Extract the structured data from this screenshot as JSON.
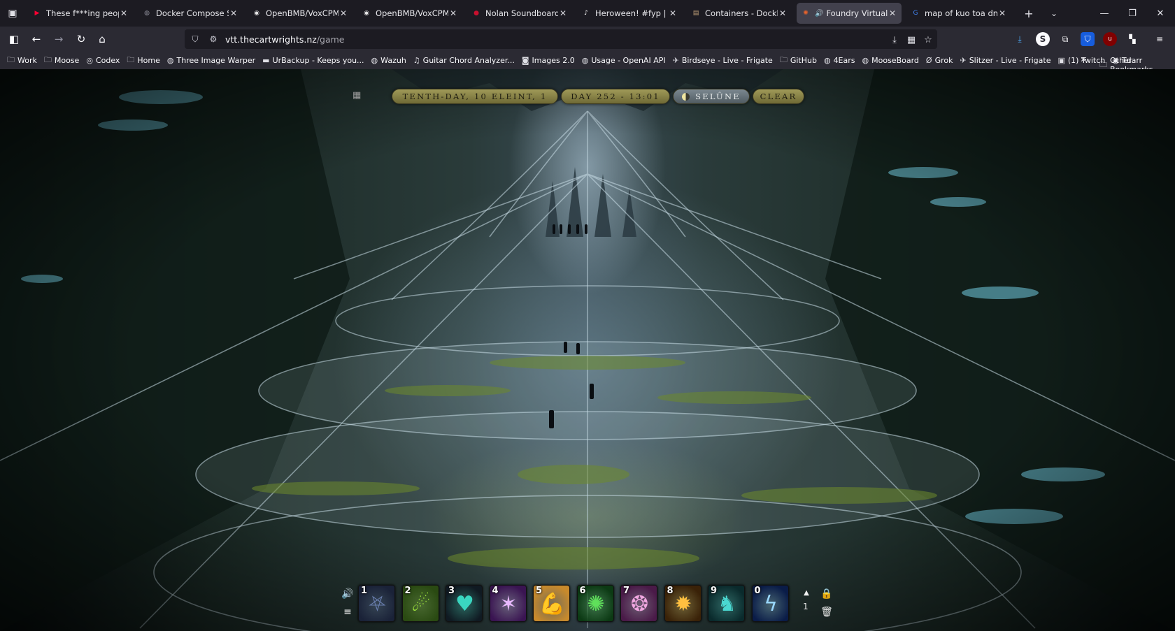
{
  "tabs": [
    {
      "title": "These f***ing people, n",
      "favicon_color": "#ff0033",
      "favicon": "youtube-icon"
    },
    {
      "title": "Docker Compose Setup",
      "favicon_color": "#8a8a96",
      "favicon": "globe-icon"
    },
    {
      "title": "OpenBMB/VoxCPM: Vo",
      "favicon_color": "#e6e6e6",
      "favicon": "github-icon"
    },
    {
      "title": "OpenBMB/VoxCPM: Vo",
      "favicon_color": "#e6e6e6",
      "favicon": "github-icon"
    },
    {
      "title": "Nolan Soundboard - In",
      "favicon_color": "#c8102e",
      "favicon": "soundboard-icon"
    },
    {
      "title": "Heroween! #fyp | TikTo",
      "favicon_color": "#ffffff",
      "favicon": "tiktok-icon"
    },
    {
      "title": "Containers - Dockhand",
      "favicon_color": "#c4a37a",
      "favicon": "dockhand-icon"
    },
    {
      "title": "Foundry Virtual Tab",
      "favicon_color": "#e8632c",
      "favicon": "foundry-icon",
      "active": true
    },
    {
      "title": "map of kuo toa dnd - G",
      "favicon_color": "#4285f4",
      "favicon": "google-icon"
    }
  ],
  "address": {
    "host": "vtt.thecartwrights.nz",
    "path": "/game"
  },
  "bookmarks": [
    {
      "label": "Work",
      "icon": "folder-icon"
    },
    {
      "label": "Moose",
      "icon": "folder-icon"
    },
    {
      "label": "Codex",
      "icon": "codex-icon"
    },
    {
      "label": "Home",
      "icon": "folder-icon"
    },
    {
      "label": "Three Image Warper",
      "icon": "globe-icon"
    },
    {
      "label": "UrBackup - Keeps you...",
      "icon": "urbackup-icon"
    },
    {
      "label": "Wazuh",
      "icon": "globe-icon"
    },
    {
      "label": "Guitar Chord Analyzer...",
      "icon": "guitar-icon"
    },
    {
      "label": "Images 2.0",
      "icon": "images-icon"
    },
    {
      "label": "Usage - OpenAI API",
      "icon": "globe-icon"
    },
    {
      "label": "Birdseye - Live - Frigate",
      "icon": "frigate-icon"
    },
    {
      "label": "GitHub",
      "icon": "folder-icon"
    },
    {
      "label": "4Ears",
      "icon": "globe-icon"
    },
    {
      "label": "MooseBoard",
      "icon": "globe-icon"
    },
    {
      "label": "Grok",
      "icon": "grok-icon"
    },
    {
      "label": "Slitzer - Live - Frigate",
      "icon": "frigate-icon"
    },
    {
      "label": "(1) Twitch",
      "icon": "twitch-icon"
    },
    {
      "label": "Tdarr",
      "icon": "tdarr-icon"
    }
  ],
  "bookmarks_other": "Other Bookmarks",
  "calendar": {
    "date": "TENTH-DAY, 10 ELEINT, 1",
    "day_time": "DAY 252 - 13:01",
    "moon": "SELÛNE",
    "weather": "CLEAR"
  },
  "hotbar": {
    "page": "1",
    "macros": [
      {
        "key": "1",
        "icon": "raven-icon",
        "bg": "#1a2238",
        "fg": "#6a7fb0"
      },
      {
        "key": "2",
        "icon": "acid-splash-icon",
        "bg": "#2a4a12",
        "fg": "#9be03c"
      },
      {
        "key": "3",
        "icon": "heart-heal-icon",
        "bg": "#101a22",
        "fg": "#3ad6c0"
      },
      {
        "key": "4",
        "icon": "arcane-rune-icon",
        "bg": "#3a1452",
        "fg": "#e8b8ff"
      },
      {
        "key": "5",
        "icon": "muscle-arm-icon",
        "bg": "#c88a2c",
        "fg": "#f4c98a"
      },
      {
        "key": "6",
        "icon": "nature-burst-icon",
        "bg": "#0c3a14",
        "fg": "#5fe05a"
      },
      {
        "key": "7",
        "icon": "pink-swirl-icon",
        "bg": "#4a1a48",
        "fg": "#f0a6e0"
      },
      {
        "key": "8",
        "icon": "fire-strike-icon",
        "bg": "#3a2208",
        "fg": "#ffc040"
      },
      {
        "key": "9",
        "icon": "spirit-stag-icon",
        "bg": "#0a2a2c",
        "fg": "#4ad8d0"
      },
      {
        "key": "0",
        "icon": "lightning-icon",
        "bg": "#0a1c48",
        "fg": "#9ad8ff"
      }
    ]
  }
}
